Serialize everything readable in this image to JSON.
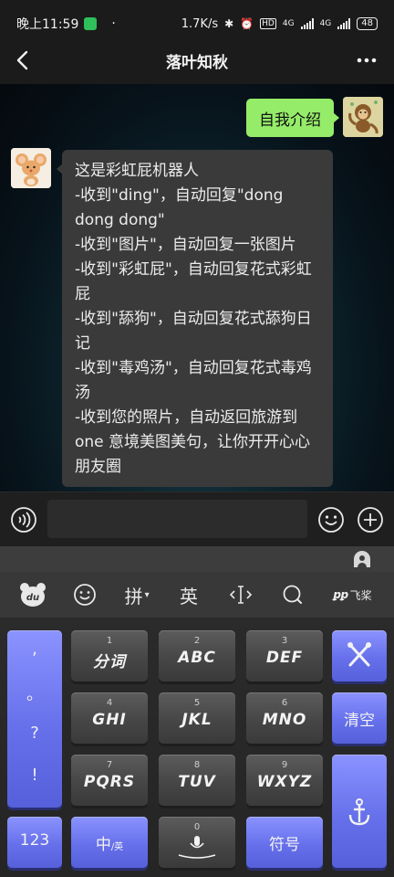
{
  "status_bar": {
    "time": "晚上11:59",
    "dot": "·",
    "speed": "1.7K/s",
    "net1": "4G",
    "net2": "4G",
    "hd": "HD",
    "battery": "48"
  },
  "header": {
    "title": "落叶知秋",
    "back_icon": "chevron-left-icon",
    "more_icon": "more-dots-icon"
  },
  "chat": {
    "messages": [
      {
        "from": "me",
        "text": "自我介绍"
      },
      {
        "from": "bot",
        "lines": [
          "这是彩虹屁机器人",
          "-收到\"ding\"，自动回复\"dong dong dong\"",
          "-收到\"图片\"，自动回复一张图片",
          "-收到\"彩虹屁\"，自动回复花式彩虹屁",
          "-收到\"舔狗\"，自动回复花式舔狗日记",
          "-收到\"毒鸡汤\"，自动回复花式毒鸡汤",
          "-收到您的照片，自动返回旅游到one 意境美图美句，让你开开心心朋友圈"
        ]
      }
    ]
  },
  "input_bar": {
    "value": "",
    "placeholder": ""
  },
  "keyboard": {
    "toolbar": {
      "logo": "du",
      "pinyin": "拼",
      "english": "英",
      "brand": "飞桨"
    },
    "punct": [
      ",",
      "。",
      "?",
      "!"
    ],
    "keys": [
      {
        "num": "1",
        "letters": "分词"
      },
      {
        "num": "2",
        "letters": "ABC"
      },
      {
        "num": "3",
        "letters": "DEF"
      },
      {
        "num": "4",
        "letters": "GHI"
      },
      {
        "num": "5",
        "letters": "JKL"
      },
      {
        "num": "6",
        "letters": "MNO"
      },
      {
        "num": "7",
        "letters": "PQRS"
      },
      {
        "num": "8",
        "letters": "TUV"
      },
      {
        "num": "9",
        "letters": "WXYZ"
      }
    ],
    "clear_label": "清空",
    "num_switch_label": "123",
    "lang_label": "中",
    "lang_sub": "/英",
    "zero_label": "0",
    "symbol_label": "符号"
  }
}
